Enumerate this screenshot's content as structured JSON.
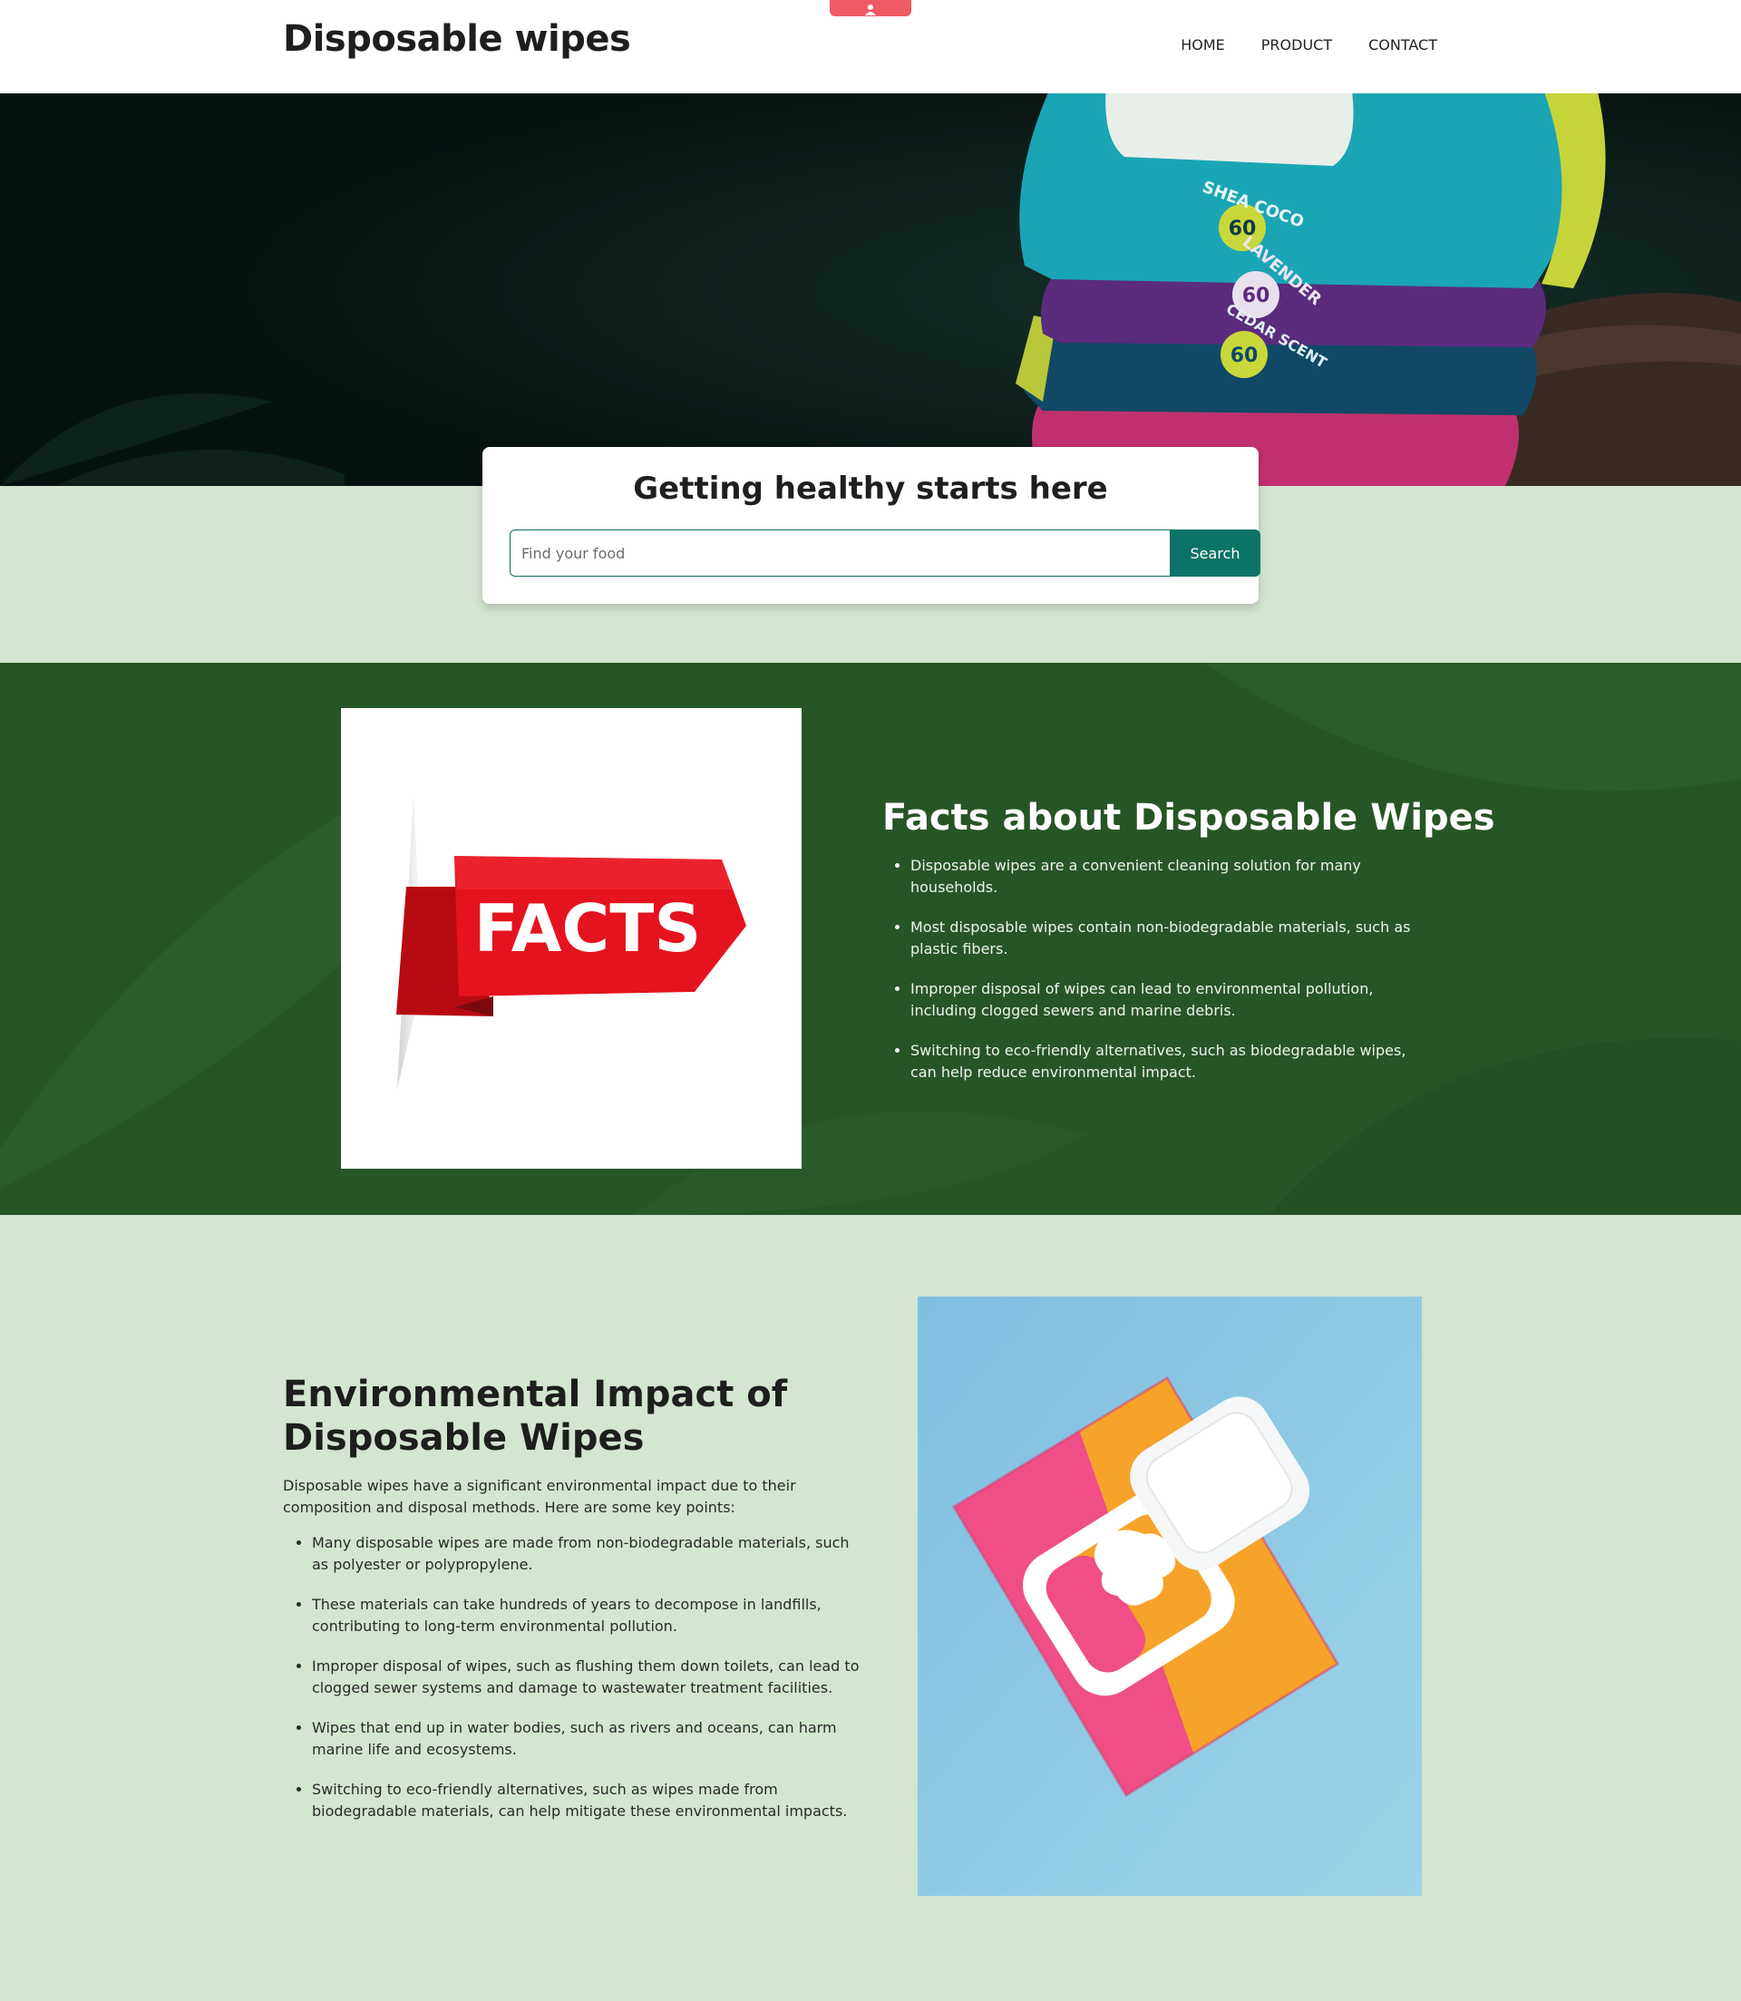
{
  "header": {
    "brand": "Disposable wipes",
    "nav": [
      "HOME",
      "PRODUCT",
      "CONTACT"
    ]
  },
  "hero": {
    "packs": [
      {
        "label": "SHEA COCO",
        "count": "60",
        "color": "#1aa5b5"
      },
      {
        "label": "LAVENDER",
        "count": "60",
        "color": "#5b2b7e"
      },
      {
        "label": "CEDAR SCENT",
        "count": "60",
        "color": "#104866"
      }
    ]
  },
  "search": {
    "title": "Getting healthy starts here",
    "placeholder": "Find your food",
    "button": "Search"
  },
  "facts": {
    "image_label": "FACTS",
    "title": "Facts about Disposable Wipes",
    "items": [
      "Disposable wipes are a convenient cleaning solution for many households.",
      "Most disposable wipes contain non-biodegradable materials, such as plastic fibers.",
      "Improper disposal of wipes can lead to environmental pollution, including clogged sewers and marine debris.",
      "Switching to eco-friendly alternatives, such as biodegradable wipes, can help reduce environmental impact."
    ]
  },
  "environment": {
    "title": "Environmental Impact of Disposable Wipes",
    "intro": "Disposable wipes have a significant environmental impact due to their composition and disposal methods. Here are some key points:",
    "items": [
      "Many disposable wipes are made from non-biodegradable materials, such as polyester or polypropylene.",
      "These materials can take hundreds of years to decompose in landfills, contributing to long-term environmental pollution.",
      "Improper disposal of wipes, such as flushing them down toilets, can lead to clogged sewer systems and damage to wastewater treatment facilities.",
      "Wipes that end up in water bodies, such as rivers and oceans, can harm marine life and ecosystems.",
      "Switching to eco-friendly alternatives, such as wipes made from biodegradable materials, can help mitigate these environmental impacts."
    ]
  },
  "colors": {
    "accent": "#0b7466",
    "page_bg": "#d4e5d1",
    "facts_bg": "#275626",
    "top_tab": "#f05a64"
  },
  "icons": {
    "top_tab": "person-icon"
  }
}
